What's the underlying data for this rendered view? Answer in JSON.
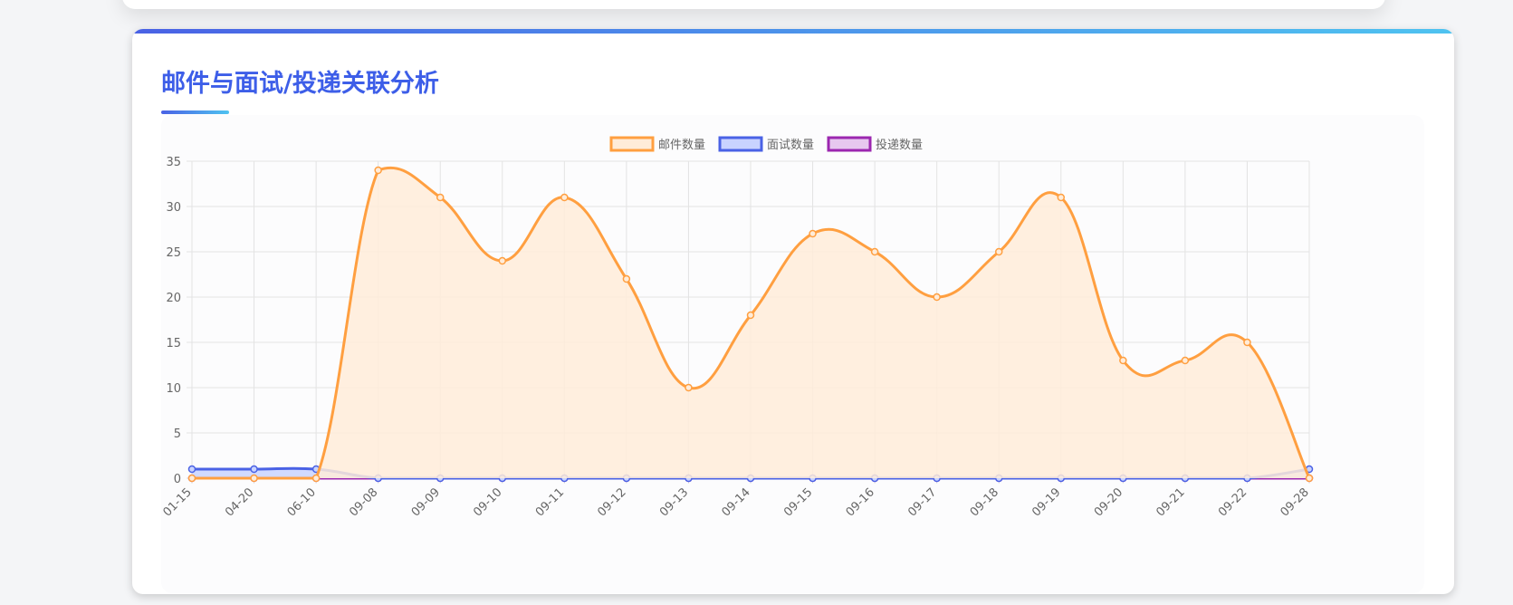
{
  "card": {
    "title": "邮件与面试/投递关联分析"
  },
  "chart_data": {
    "type": "line",
    "categories": [
      "01-15",
      "04-20",
      "06-10",
      "09-08",
      "09-09",
      "09-10",
      "09-11",
      "09-12",
      "09-13",
      "09-14",
      "09-15",
      "09-16",
      "09-17",
      "09-18",
      "09-19",
      "09-20",
      "09-21",
      "09-22",
      "09-28"
    ],
    "series": [
      {
        "name": "邮件数量",
        "values": [
          0,
          0,
          0,
          34,
          31,
          24,
          31,
          22,
          10,
          18,
          27,
          25,
          20,
          25,
          31,
          13,
          13,
          15,
          0
        ],
        "color": "#ff9f40",
        "fill": "#ffecd9",
        "filled": true
      },
      {
        "name": "面试数量",
        "values": [
          1,
          1,
          1,
          0,
          0,
          0,
          0,
          0,
          0,
          0,
          0,
          0,
          0,
          0,
          0,
          0,
          0,
          0,
          1
        ],
        "color": "#4a62e5",
        "fill": "#c9d3ff",
        "filled": true
      },
      {
        "name": "投递数量",
        "values": [
          0,
          0,
          0,
          0,
          0,
          0,
          0,
          0,
          0,
          0,
          0,
          0,
          0,
          0,
          0,
          0,
          0,
          0,
          0
        ],
        "color": "#9c27b0",
        "fill": "#e7c8ef",
        "filled": false
      }
    ],
    "title": "",
    "xlabel": "",
    "ylabel": "",
    "ylim": [
      0,
      35
    ],
    "yticks": [
      0,
      5,
      10,
      15,
      20,
      25,
      30,
      35
    ],
    "grid": true,
    "legend": "top-center"
  }
}
